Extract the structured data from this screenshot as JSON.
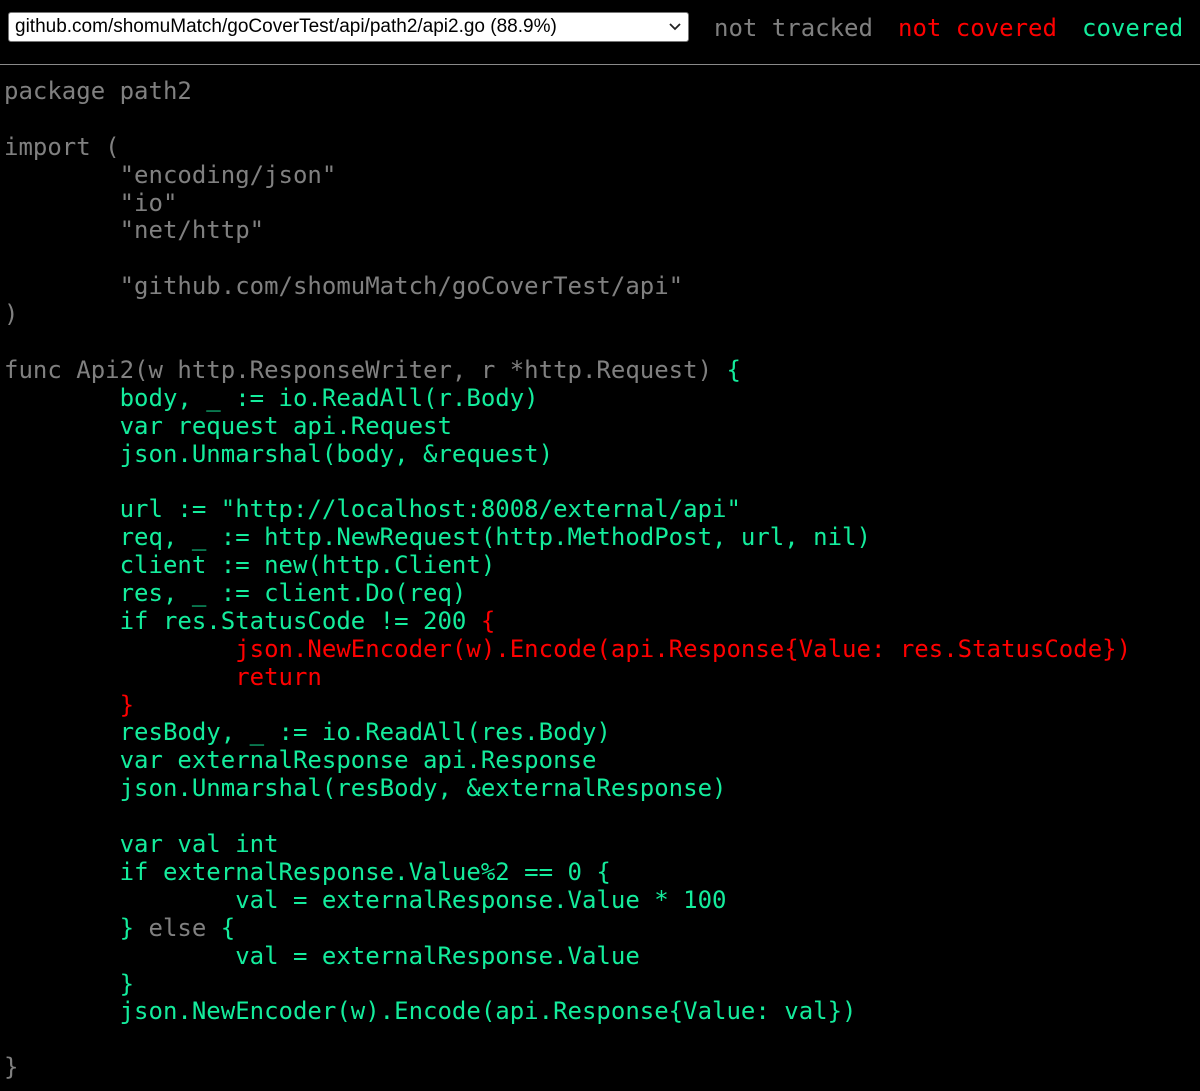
{
  "file_select": {
    "selected": "github.com/shomuMatch/goCoverTest/api/path2/api2.go (88.9%)"
  },
  "legend": {
    "not_tracked": "not tracked",
    "not_covered": "not covered",
    "covered": "covered"
  },
  "colors": {
    "background": "#000000",
    "not_tracked": "#808080",
    "not_covered": "#ff0000",
    "covered": "#14ec9c"
  },
  "source_lines": [
    [
      {
        "text": "package path2",
        "cov": "nt"
      }
    ],
    [
      {
        "text": "",
        "cov": "nt"
      }
    ],
    [
      {
        "text": "import (",
        "cov": "nt"
      }
    ],
    [
      {
        "text": "        \"encoding/json\"",
        "cov": "nt"
      }
    ],
    [
      {
        "text": "        \"io\"",
        "cov": "nt"
      }
    ],
    [
      {
        "text": "        \"net/http\"",
        "cov": "nt"
      }
    ],
    [
      {
        "text": "",
        "cov": "nt"
      }
    ],
    [
      {
        "text": "        \"github.com/shomuMatch/goCoverTest/api\"",
        "cov": "nt"
      }
    ],
    [
      {
        "text": ")",
        "cov": "nt"
      }
    ],
    [
      {
        "text": "",
        "cov": "nt"
      }
    ],
    [
      {
        "text": "func Api2(w http.ResponseWriter, r *http.Request) ",
        "cov": "nt"
      },
      {
        "text": "{",
        "cov": "c"
      }
    ],
    [
      {
        "text": "        body, _ := io.ReadAll(r.Body)",
        "cov": "c"
      }
    ],
    [
      {
        "text": "        var request api.Request",
        "cov": "c"
      }
    ],
    [
      {
        "text": "        json.Unmarshal(body, &request)",
        "cov": "c"
      }
    ],
    [
      {
        "text": "",
        "cov": "nt"
      }
    ],
    [
      {
        "text": "        url := \"http://localhost:8008/external/api\"",
        "cov": "c"
      }
    ],
    [
      {
        "text": "        req, _ := http.NewRequest(http.MethodPost, url, nil)",
        "cov": "c"
      }
    ],
    [
      {
        "text": "        client := new(http.Client)",
        "cov": "c"
      }
    ],
    [
      {
        "text": "        res, _ := client.Do(req)",
        "cov": "c"
      }
    ],
    [
      {
        "text": "        if res.StatusCode != 200 ",
        "cov": "c"
      },
      {
        "text": "{",
        "cov": "u"
      }
    ],
    [
      {
        "text": "                json.NewEncoder(w).Encode(api.Response{Value: res.StatusCode})",
        "cov": "u"
      }
    ],
    [
      {
        "text": "                return",
        "cov": "u"
      }
    ],
    [
      {
        "text": "        }",
        "cov": "u"
      }
    ],
    [
      {
        "text": "        resBody, _ := io.ReadAll(res.Body)",
        "cov": "c"
      }
    ],
    [
      {
        "text": "        var externalResponse api.Response",
        "cov": "c"
      }
    ],
    [
      {
        "text": "        json.Unmarshal(resBody, &externalResponse)",
        "cov": "c"
      }
    ],
    [
      {
        "text": "",
        "cov": "nt"
      }
    ],
    [
      {
        "text": "        var val int",
        "cov": "c"
      }
    ],
    [
      {
        "text": "        if externalResponse.Value%2 == 0 {",
        "cov": "c"
      }
    ],
    [
      {
        "text": "                val = externalResponse.Value * 100",
        "cov": "c"
      }
    ],
    [
      {
        "text": "        }",
        "cov": "c"
      },
      {
        "text": " else ",
        "cov": "nt"
      },
      {
        "text": "{",
        "cov": "c"
      }
    ],
    [
      {
        "text": "                val = externalResponse.Value",
        "cov": "c"
      }
    ],
    [
      {
        "text": "        }",
        "cov": "c"
      }
    ],
    [
      {
        "text": "        json.NewEncoder(w).Encode(api.Response{Value: val})",
        "cov": "c"
      }
    ],
    [
      {
        "text": "",
        "cov": "nt"
      }
    ],
    [
      {
        "text": "}",
        "cov": "nt"
      }
    ]
  ]
}
